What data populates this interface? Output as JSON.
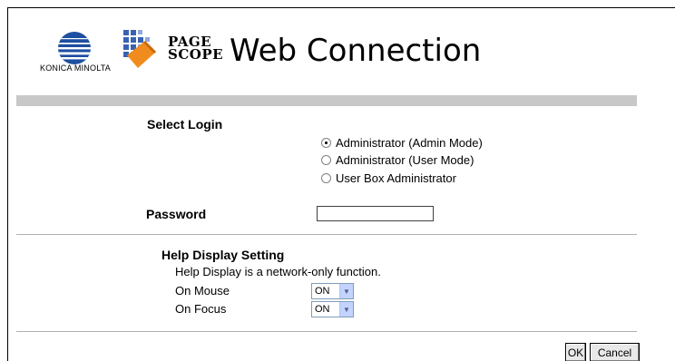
{
  "header": {
    "brand_text": "KONICA MINOLTA",
    "pagescope_line1": "PAGE",
    "pagescope_line2": "SCOPE",
    "title": "Web Connection"
  },
  "login": {
    "section_label": "Select Login",
    "options": [
      {
        "label": "Administrator (Admin Mode)",
        "selected": true
      },
      {
        "label": "Administrator (User Mode)",
        "selected": false
      },
      {
        "label": "User Box Administrator",
        "selected": false
      }
    ],
    "password_label": "Password",
    "password_value": ""
  },
  "help": {
    "section_label": "Help Display Setting",
    "note": "Help Display is a network-only function.",
    "on_mouse_label": "On Mouse",
    "on_mouse_value": "ON",
    "on_focus_label": "On Focus",
    "on_focus_value": "ON"
  },
  "buttons": {
    "ok_label": "OK",
    "cancel_label": "Cancel"
  },
  "colors": {
    "globe_blue": "#1e4fa0",
    "pagescope_blue": "#3a62b3",
    "pagescope_orange": "#f08c1e",
    "separator_grey": "#c8c8c8"
  }
}
